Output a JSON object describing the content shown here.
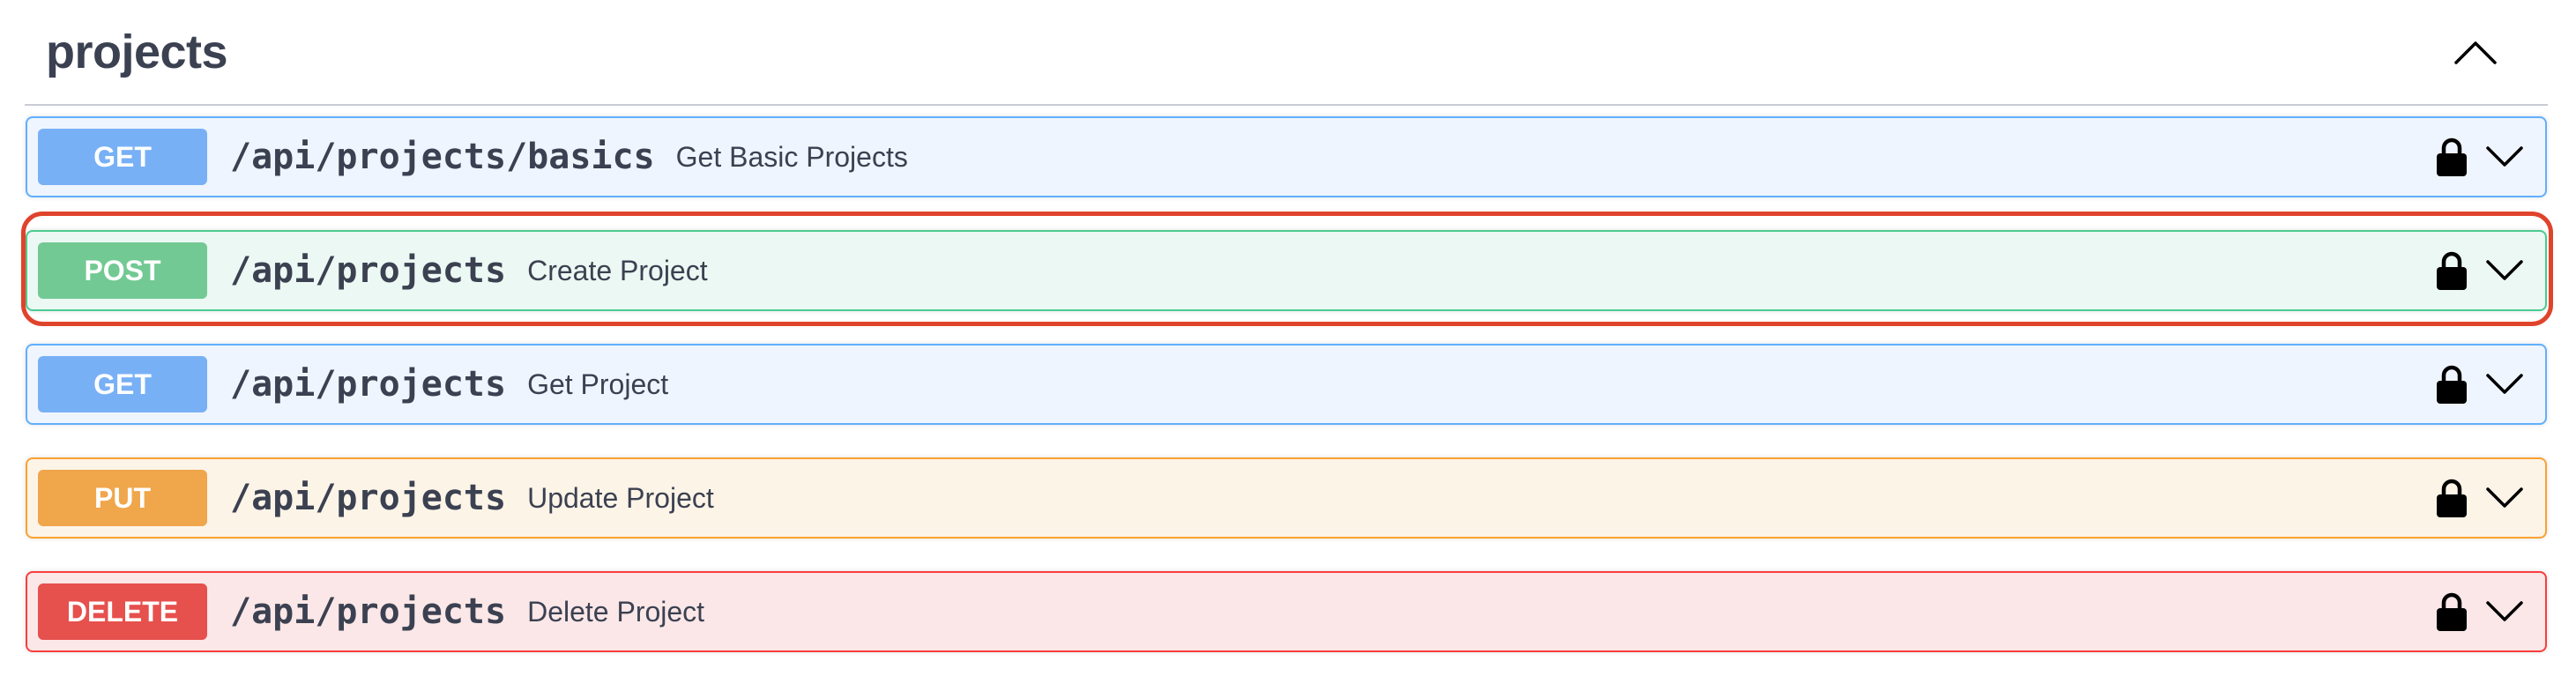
{
  "section": {
    "title": "projects",
    "collapse_icon": "chevron-up-icon"
  },
  "operations": [
    {
      "method": "GET",
      "path": "/api/projects/basics",
      "summary": "Get Basic Projects",
      "color": "#61affe",
      "lock_icon": "lock-icon",
      "expand_icon": "chevron-down-icon"
    },
    {
      "method": "POST",
      "path": "/api/projects",
      "summary": "Create Project",
      "color": "#49cc90",
      "lock_icon": "lock-icon",
      "expand_icon": "chevron-down-icon",
      "highlighted": true,
      "highlight_color": "#e0432c"
    },
    {
      "method": "GET",
      "path": "/api/projects",
      "summary": "Get Project",
      "color": "#61affe",
      "lock_icon": "lock-icon",
      "expand_icon": "chevron-down-icon"
    },
    {
      "method": "PUT",
      "path": "/api/projects",
      "summary": "Update Project",
      "color": "#fca130",
      "lock_icon": "lock-icon",
      "expand_icon": "chevron-down-icon"
    },
    {
      "method": "DELETE",
      "path": "/api/projects",
      "summary": "Delete Project",
      "color": "#f93e3e",
      "lock_icon": "lock-icon",
      "expand_icon": "chevron-down-icon"
    }
  ]
}
